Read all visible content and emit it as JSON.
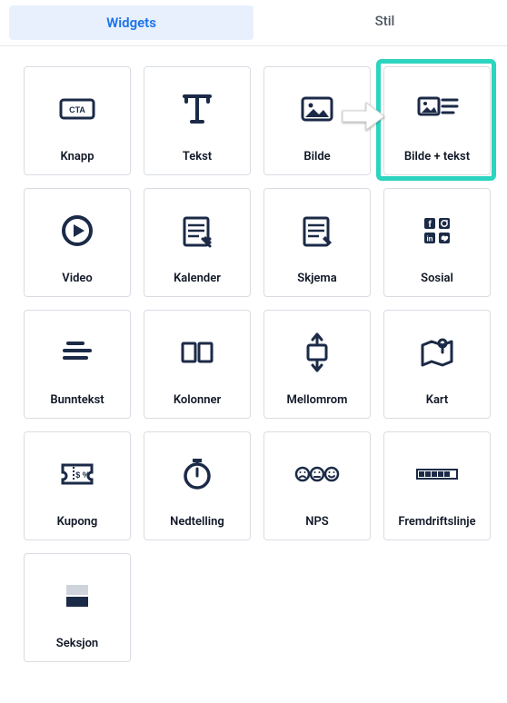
{
  "tabs": {
    "widgets": "Widgets",
    "style": "Stil",
    "active": "widgets"
  },
  "widgets": [
    {
      "id": "button",
      "label": "Knapp",
      "icon": "cta-icon"
    },
    {
      "id": "text",
      "label": "Tekst",
      "icon": "text-icon"
    },
    {
      "id": "image",
      "label": "Bilde",
      "icon": "image-icon"
    },
    {
      "id": "image-text",
      "label": "Bilde + tekst",
      "icon": "image-text-icon",
      "highlighted": true
    },
    {
      "id": "video",
      "label": "Video",
      "icon": "video-icon"
    },
    {
      "id": "calendar",
      "label": "Kalender",
      "icon": "calendar-icon"
    },
    {
      "id": "form",
      "label": "Skjema",
      "icon": "form-icon"
    },
    {
      "id": "social",
      "label": "Sosial",
      "icon": "social-icon"
    },
    {
      "id": "footer",
      "label": "Bunntekst",
      "icon": "footer-icon"
    },
    {
      "id": "columns",
      "label": "Kolonner",
      "icon": "columns-icon"
    },
    {
      "id": "spacer",
      "label": "Mellomrom",
      "icon": "spacer-icon"
    },
    {
      "id": "map",
      "label": "Kart",
      "icon": "map-icon"
    },
    {
      "id": "coupon",
      "label": "Kupong",
      "icon": "coupon-icon"
    },
    {
      "id": "countdown",
      "label": "Nedtelling",
      "icon": "countdown-icon"
    },
    {
      "id": "nps",
      "label": "NPS",
      "icon": "nps-icon"
    },
    {
      "id": "progress",
      "label": "Fremdriftslinje",
      "icon": "progress-icon"
    },
    {
      "id": "section",
      "label": "Seksjon",
      "icon": "section-icon"
    }
  ],
  "colors": {
    "iconColor": "#1b2a47",
    "tabActiveBg": "#e8f0fe",
    "tabActiveText": "#1a73e8",
    "highlight": "#2dd4bf"
  }
}
